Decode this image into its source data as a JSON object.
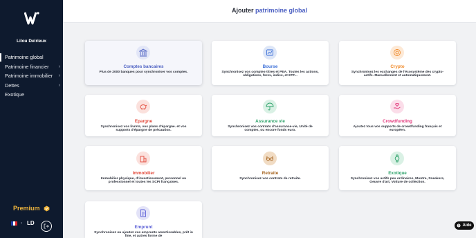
{
  "header": {
    "title_prefix": "Ajouter",
    "title_accent": "patrimoine global"
  },
  "sidebar": {
    "user_name": "Lilou Delrieux",
    "items": [
      {
        "label": "Patrimoine global"
      },
      {
        "label": "Patrimoine financier"
      },
      {
        "label": "Patrimoine immobilier"
      },
      {
        "label": "Dettes"
      },
      {
        "label": "Exotique"
      }
    ],
    "premium_label": "Premium",
    "initials": "LD"
  },
  "cards": [
    {
      "title": "Comptes bancaires",
      "desc": "Plus de 2000 banques pour synchroniser vos comptes.",
      "color": "#4b5fc2",
      "icon": "bank-icon"
    },
    {
      "title": "Bourse",
      "desc": "Synchronisez vos comptes-titres et PEA. Toutes les actions, obligations, forex, indice, et ETF...",
      "color": "#3b6fd8",
      "icon": "chart-icon"
    },
    {
      "title": "Crypto",
      "desc": "Synchronisez les exchanges de l'écosystème des crypto-actifs. Manuellement et automatiquement.",
      "color": "#f08a2a",
      "icon": "crypto-icon"
    },
    {
      "title": "Epargne",
      "desc": "Synchronisez vos livrets, vos plans d'épargne. et vos supports d'épargne de précaution.",
      "color": "#e24a3b",
      "icon": "piggy-bank-icon"
    },
    {
      "title": "Assurance vie",
      "desc": "Synchronisez vos contrats d'assurance-vie, Unité de comptes, ou encore fonds euro.",
      "color": "#2ea26a",
      "icon": "umbrella-icon"
    },
    {
      "title": "Crowdfunding",
      "desc": "Ajoutez tous vos supports de crowdfunding français et européen.",
      "color": "#e2357a",
      "icon": "hand-heart-icon"
    },
    {
      "title": "Immobilier",
      "desc": "Immobilier physique, d'investissement, personnel ou professionnel et toutes les SCPI françaises.",
      "color": "#e24a3b",
      "icon": "building-icon"
    },
    {
      "title": "Retraite",
      "desc": "Synchronisez vos contrats de retraite.",
      "color": "#a4621d",
      "icon": "glasses-icon"
    },
    {
      "title": "Exotique",
      "desc": "Synchronisez vos actifs peu ordinaires, Montre, Sneakers, Oeuvre d'art, Voiture de collection.",
      "color": "#2ea26a",
      "icon": "watch-icon"
    },
    {
      "title": "Emprunt",
      "desc": "Synchronisez ou ajoutez vos emprunts amortissables, prêt in fine, et autres forme de",
      "color": "#5b5fd6",
      "icon": "document-icon"
    }
  ],
  "help": {
    "label": "Aide"
  }
}
